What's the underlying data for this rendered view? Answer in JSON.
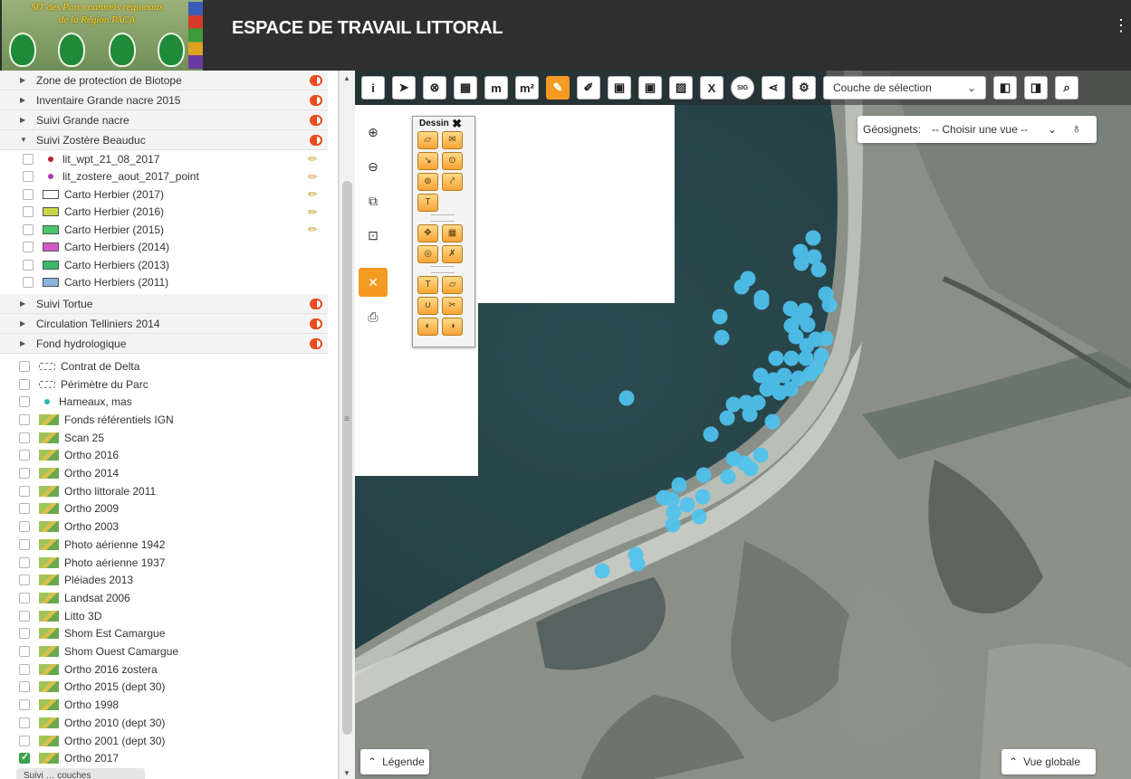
{
  "header": {
    "logo_line1": "SIT des Parcs naturels régionaux",
    "logo_line2": "de la Région PACA",
    "title": "ESPACE DE TRAVAIL LITTORAL"
  },
  "layers": {
    "groups_top": [
      {
        "label": "Zone de protection de Biotope"
      },
      {
        "label": "Inventaire Grande nacre 2015"
      },
      {
        "label": "Suivi Grande nacre"
      },
      {
        "label": "Suivi Zostère Beauduc",
        "expanded": true
      }
    ],
    "sub_items": [
      {
        "label": "lit_wpt_21_08_2017",
        "color": "#b3222e",
        "kind": "dot",
        "editable": true
      },
      {
        "label": "lit_zostere_aout_2017_point",
        "color": "#a83aa8",
        "kind": "dot",
        "editable": true
      },
      {
        "label": "Carto Herbier (2017)",
        "color": "#ffffff",
        "kind": "rect",
        "editable": true
      },
      {
        "label": "Carto Herbier (2016)",
        "color": "#c8d44a",
        "kind": "rect",
        "editable": true
      },
      {
        "label": "Carto Herbier (2015)",
        "color": "#4ac86a",
        "kind": "rect",
        "editable": true
      },
      {
        "label": "Carto Herbiers (2014)",
        "color": "#d45ac8",
        "kind": "rect",
        "editable": false
      },
      {
        "label": "Carto Herbiers (2013)",
        "color": "#3ab86a",
        "kind": "rect",
        "editable": false
      },
      {
        "label": "Carto Herbiers (2011)",
        "color": "#8ab4e0",
        "kind": "rect",
        "editable": false
      }
    ],
    "groups_bottom": [
      {
        "label": "Suivi Tortue"
      },
      {
        "label": "Circulation Telliniers 2014"
      },
      {
        "label": "Fond hydrologique"
      }
    ],
    "base_layers": [
      {
        "label": "Contrat de Delta",
        "kind": "dash",
        "checked": false
      },
      {
        "label": "Périmètre du Parc",
        "kind": "dash",
        "checked": false
      },
      {
        "label": "Hameaux, mas",
        "kind": "dot",
        "checked": false
      },
      {
        "label": "Fonds référentiels IGN",
        "kind": "map",
        "checked": false
      },
      {
        "label": "Scan 25",
        "kind": "map",
        "checked": false
      },
      {
        "label": "Ortho 2016",
        "kind": "map",
        "checked": false
      },
      {
        "label": "Ortho 2014",
        "kind": "map",
        "checked": false
      },
      {
        "label": "Ortho littorale 2011",
        "kind": "map",
        "checked": false
      },
      {
        "label": "Ortho 2009",
        "kind": "map",
        "checked": false
      },
      {
        "label": "Ortho 2003",
        "kind": "map",
        "checked": false
      },
      {
        "label": "Photo aérienne 1942",
        "kind": "map",
        "checked": false
      },
      {
        "label": "Photo aérienne 1937",
        "kind": "map",
        "checked": false
      },
      {
        "label": "Pléiades 2013",
        "kind": "map",
        "checked": false
      },
      {
        "label": "Landsat 2006",
        "kind": "map",
        "checked": false
      },
      {
        "label": "Litto 3D",
        "kind": "map",
        "checked": false
      },
      {
        "label": "Shom Est Camargue",
        "kind": "map",
        "checked": false
      },
      {
        "label": "Shom Ouest Camargue",
        "kind": "map",
        "checked": false
      },
      {
        "label": "Ortho 2016 zostera",
        "kind": "map",
        "checked": false
      },
      {
        "label": "Ortho 2015 (dept 30)",
        "kind": "map",
        "checked": false
      },
      {
        "label": "Ortho 1998",
        "kind": "map",
        "checked": false
      },
      {
        "label": "Ortho 2010 (dept 30)",
        "kind": "map",
        "checked": false
      },
      {
        "label": "Ortho 2001 (dept 30)",
        "kind": "map",
        "checked": false
      },
      {
        "label": "Ortho 2017",
        "kind": "map",
        "checked": true
      }
    ]
  },
  "toolbar": {
    "selection_layer": "Couche de sélection",
    "buttons": [
      {
        "name": "info-button",
        "glyph": "i"
      },
      {
        "name": "select-arrow-button",
        "glyph": "➤"
      },
      {
        "name": "compass-button",
        "glyph": "⊗"
      },
      {
        "name": "table-export-button",
        "glyph": "▦"
      },
      {
        "name": "measure-length-button",
        "glyph": "m"
      },
      {
        "name": "measure-area-button",
        "glyph": "m²"
      },
      {
        "name": "draw-pencil-button",
        "glyph": "✎",
        "active": true
      },
      {
        "name": "edit-attributes-button",
        "glyph": "✐"
      },
      {
        "name": "mask-button",
        "glyph": "▣"
      },
      {
        "name": "mask-edit-button",
        "glyph": "▣"
      },
      {
        "name": "image-button",
        "glyph": "▨"
      },
      {
        "name": "close-x-button",
        "glyph": "X"
      },
      {
        "name": "sig-button",
        "glyph": "SIG"
      },
      {
        "name": "share-button",
        "glyph": "⋖"
      },
      {
        "name": "settings-gear-button",
        "glyph": "⚙"
      }
    ],
    "right_buttons": [
      {
        "name": "select-layer-button",
        "glyph": "◧"
      },
      {
        "name": "select-layer-alt-button",
        "glyph": "◨"
      },
      {
        "name": "search-button",
        "glyph": "⌕"
      }
    ]
  },
  "side_tools": [
    {
      "name": "zoom-in-button",
      "glyph": "⊕"
    },
    {
      "name": "zoom-out-button",
      "glyph": "⊖"
    },
    {
      "name": "zoom-box-button",
      "glyph": "⧉"
    },
    {
      "name": "zoom-extent-button",
      "glyph": "⊡"
    },
    {
      "name": "tools-button",
      "glyph": "✕",
      "orange": true
    },
    {
      "name": "print-button",
      "glyph": "⎙"
    }
  ],
  "dessin": {
    "title": "Dessin",
    "close": "✖",
    "group1": [
      "▱",
      "✉",
      "↘",
      "⊙",
      "⊚",
      "⤤"
    ],
    "group1_text": "T",
    "group2": [
      "✥",
      "▦",
      "◎",
      "✗"
    ],
    "group3": [
      "T",
      "▱",
      "∪",
      "✂",
      "◐",
      "◑"
    ]
  },
  "geosignets": {
    "label": "Géosignets:",
    "value": "-- Choisir une vue --"
  },
  "legend_button": "Légende",
  "overview_button": "Vue globale",
  "bottom_button": "Suivi … couches"
}
